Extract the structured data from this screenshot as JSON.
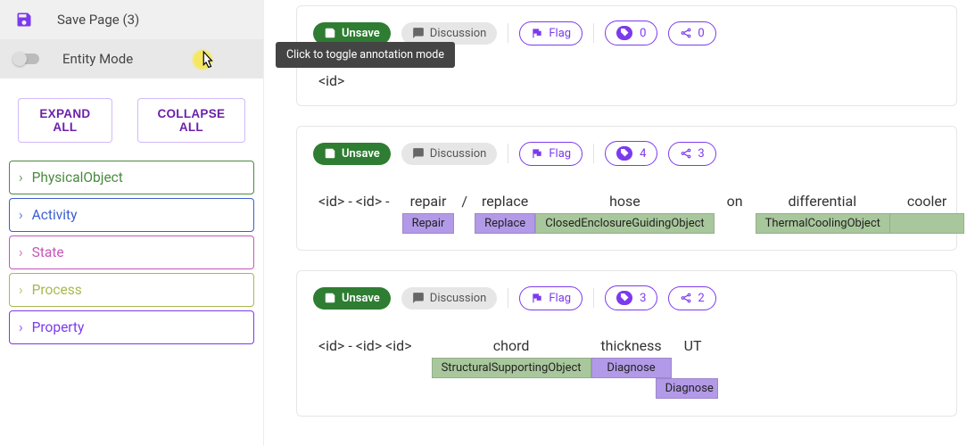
{
  "sidebar": {
    "save_label": "Save Page (3)",
    "mode_label": "Entity Mode",
    "tooltip": "Click to toggle annotation mode",
    "expand_label": "EXPAND ALL",
    "collapse_label": "COLLAPSE ALL",
    "categories": [
      {
        "label": "PhysicalObject",
        "cls": "cat-green"
      },
      {
        "label": "Activity",
        "cls": "cat-blue"
      },
      {
        "label": "State",
        "cls": "cat-pink"
      },
      {
        "label": "Process",
        "cls": "cat-olive"
      },
      {
        "label": "Property",
        "cls": "cat-purple"
      }
    ]
  },
  "buttons": {
    "unsave": "Unsave",
    "discussion": "Discussion",
    "flag": "Flag"
  },
  "cards": [
    {
      "tag_count": "0",
      "share_count": "0",
      "id_text": "<id>"
    },
    {
      "tag_count": "4",
      "share_count": "3",
      "prefix": "<id>  -  <id>  -",
      "segs": [
        {
          "word": "repair",
          "tag": "Repair",
          "tagcls": "tag-purple"
        },
        {
          "word": "/",
          "tag": ""
        },
        {
          "word": "replace",
          "tag": "Replace",
          "tagcls": "tag-purple"
        },
        {
          "word": "hose",
          "tag": "ClosedEnclosureGuidingObject",
          "tagcls": "tag-green"
        },
        {
          "word": "on",
          "tag": ""
        },
        {
          "word": "differential",
          "tag": "ThermalCoolingObject",
          "tagcls": "tag-green"
        },
        {
          "word": "cooler",
          "tag": "_cont_"
        }
      ]
    },
    {
      "tag_count": "3",
      "share_count": "2",
      "prefix": "<id>  -  <id>  <id>",
      "segs": [
        {
          "word": "chord",
          "tag": "StructuralSupportingObject",
          "tagcls": "tag-green"
        },
        {
          "word": "thickness",
          "tag": "Diagnose",
          "tagcls": "tag-purple"
        },
        {
          "word": "UT",
          "tag": ""
        }
      ],
      "extra_tag": {
        "text": "Diagnose",
        "cls": "tag-purple"
      }
    }
  ]
}
